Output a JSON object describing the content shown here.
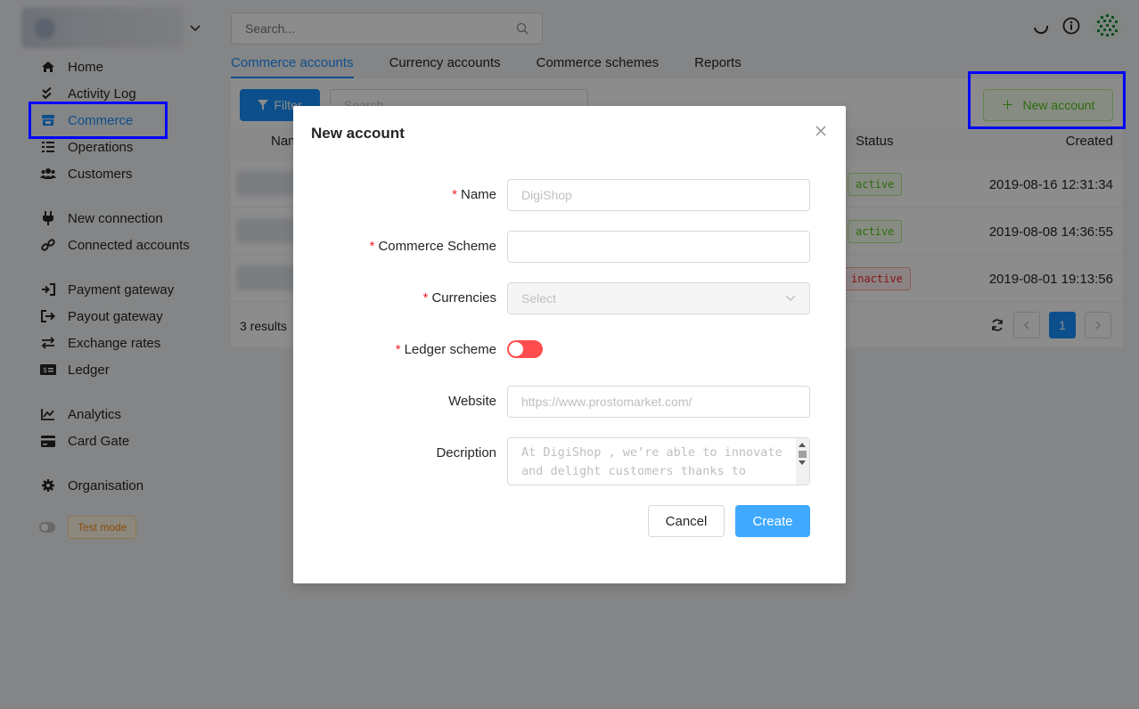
{
  "header": {
    "search_placeholder": "Search..."
  },
  "sidebar": {
    "items": [
      {
        "label": "Home",
        "icon": "home-icon"
      },
      {
        "label": "Activity Log",
        "icon": "double-check-icon"
      },
      {
        "label": "Commerce",
        "icon": "store-icon",
        "active": true
      },
      {
        "label": "Operations",
        "icon": "list-icon"
      },
      {
        "label": "Customers",
        "icon": "users-icon"
      },
      {
        "label": "New connection",
        "icon": "plug-icon"
      },
      {
        "label": "Connected accounts",
        "icon": "link-icon"
      },
      {
        "label": "Payment gateway",
        "icon": "sign-in-icon"
      },
      {
        "label": "Payout gateway",
        "icon": "sign-out-icon"
      },
      {
        "label": "Exchange rates",
        "icon": "exchange-icon"
      },
      {
        "label": "Ledger",
        "icon": "money-bill-icon"
      },
      {
        "label": "Analytics",
        "icon": "chart-line-icon"
      },
      {
        "label": "Card Gate",
        "icon": "credit-card-icon"
      },
      {
        "label": "Organisation",
        "icon": "gear-icon"
      }
    ],
    "test_mode_label": "Test mode"
  },
  "tabs": [
    {
      "label": "Commerce accounts",
      "active": true
    },
    {
      "label": "Currency accounts"
    },
    {
      "label": "Commerce schemes"
    },
    {
      "label": "Reports"
    }
  ],
  "toolbar": {
    "filter_label": "Filter",
    "search_placeholder": "Search...",
    "new_account_label": "New account"
  },
  "table": {
    "columns": {
      "name": "Name",
      "status": "Status",
      "created": "Created"
    },
    "rows": [
      {
        "status": "active",
        "created": "2019-08-16 12:31:34"
      },
      {
        "status": "active",
        "created": "2019-08-08 14:36:55"
      },
      {
        "status": "inactive",
        "created": "2019-08-01 19:13:56"
      }
    ],
    "results_text": "3 results",
    "current_page": "1"
  },
  "modal": {
    "title": "New account",
    "fields": {
      "name": {
        "label": "Name",
        "placeholder": "DigiShop"
      },
      "commerce_scheme": {
        "label": "Commerce Scheme",
        "value": ""
      },
      "currencies": {
        "label": "Currencies",
        "placeholder": "Select"
      },
      "ledger_scheme": {
        "label": "Ledger scheme",
        "enabled": false
      },
      "website": {
        "label": "Website",
        "placeholder": "https://www.prostomarket.com/"
      },
      "description": {
        "label": "Decription",
        "placeholder": "At DigiShop , we’re able to innovate and delight customers thanks to"
      }
    },
    "cancel_label": "Cancel",
    "create_label": "Create"
  },
  "colors": {
    "primary": "#1890ff",
    "success": "#52c41a",
    "danger": "#f5222d",
    "highlight": "#0000ff"
  }
}
